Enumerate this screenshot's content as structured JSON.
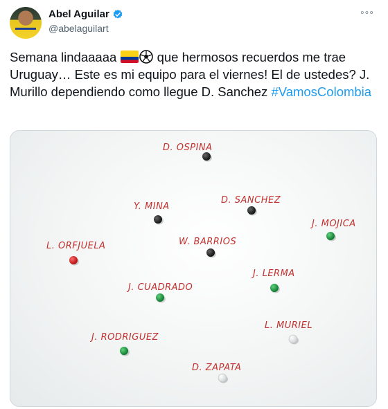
{
  "author": {
    "display_name": "Abel Aguilar",
    "handle": "@abelaguilart",
    "verified": true
  },
  "tweet": {
    "text_part1": "Semana lindaaaaa",
    "text_part2": " que hermosos recuerdos me trae Uruguay… Este es mi equipo para el viernes! El de ustedes? J. Murillo dependiendo como llegue D. Sanchez ",
    "hashtag": "#VamosColombia"
  },
  "board": {
    "players": [
      {
        "label": "D. OSPINA",
        "magnet": "black"
      },
      {
        "label": "Y. MINA",
        "magnet": "black"
      },
      {
        "label": "D. SANCHEZ",
        "magnet": "black"
      },
      {
        "label": "J. MOJICA",
        "magnet": "green"
      },
      {
        "label": "L. ORFJUELA",
        "magnet": "red"
      },
      {
        "label": "W. BARRIOS",
        "magnet": "black"
      },
      {
        "label": "J. LERMA",
        "magnet": "green"
      },
      {
        "label": "J. CUADRADO",
        "magnet": "green"
      },
      {
        "label": "J. RODRIGUEZ",
        "magnet": "green"
      },
      {
        "label": "L. MURIEL",
        "magnet": "white"
      },
      {
        "label": "D. ZAPATA",
        "magnet": "white"
      }
    ]
  },
  "colors": {
    "hashtag": "#1d9bf0",
    "marker": "#c0322f",
    "verified": "#1d9bf0"
  }
}
